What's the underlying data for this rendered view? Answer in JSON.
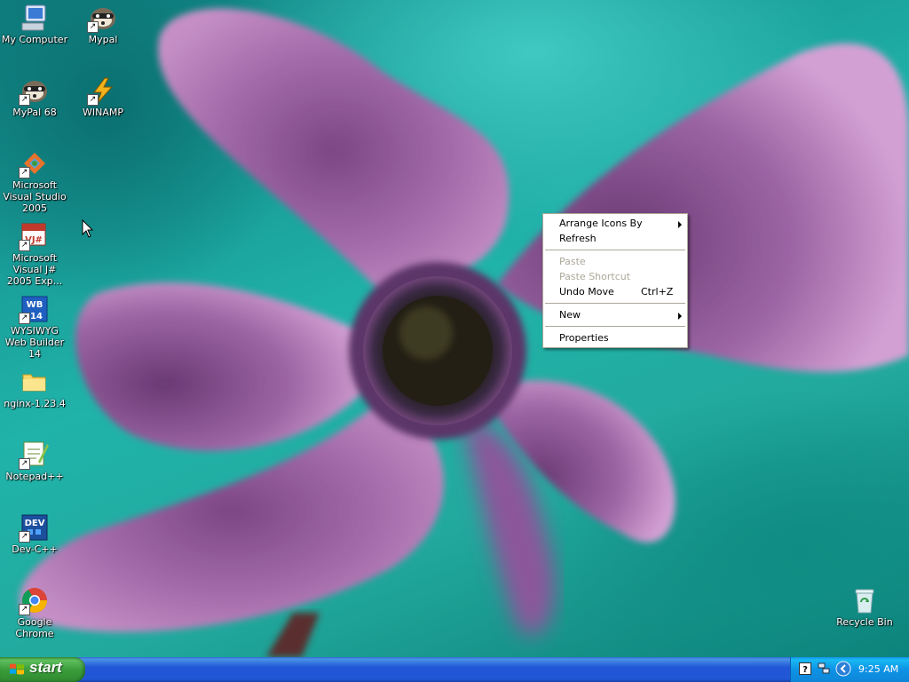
{
  "desktop": {
    "icons": [
      {
        "label": "My Computer",
        "icon": "my-computer-icon"
      },
      {
        "label": "Mypal",
        "icon": "mypal-icon"
      },
      {
        "label": "MyPal 68",
        "icon": "mypal68-icon"
      },
      {
        "label": "WINAMP",
        "icon": "winamp-icon"
      },
      {
        "label": "Microsoft Visual Studio 2005",
        "icon": "visual-studio-icon"
      },
      {
        "label": "Microsoft Visual J# 2005 Exp...",
        "icon": "visual-jsharp-icon"
      },
      {
        "label": "WYSIWYG Web Builder 14",
        "icon": "wysiwyg-web-builder-icon"
      },
      {
        "label": "nginx-1.23.4",
        "icon": "folder-icon"
      },
      {
        "label": "Notepad++",
        "icon": "notepadpp-icon"
      },
      {
        "label": "Dev-C++",
        "icon": "dev-cpp-icon"
      },
      {
        "label": "Google Chrome",
        "icon": "chrome-icon"
      },
      {
        "label": "Recycle Bin",
        "icon": "recycle-bin-icon"
      }
    ],
    "icon_texts": {
      "wysiwyg": "WB",
      "wysiwyg_version": "14",
      "devcpp": "DEV",
      "vjsharp": "VJ#"
    }
  },
  "context_menu": {
    "items": [
      {
        "label": "Arrange Icons By",
        "submenu": true,
        "disabled": false
      },
      {
        "label": "Refresh",
        "disabled": false
      },
      {
        "label": "Paste",
        "disabled": true
      },
      {
        "label": "Paste Shortcut",
        "disabled": true
      },
      {
        "label": "Undo Move",
        "shortcut": "Ctrl+Z",
        "disabled": false
      },
      {
        "label": "New",
        "submenu": true,
        "disabled": false
      },
      {
        "label": "Properties",
        "disabled": false
      }
    ]
  },
  "taskbar": {
    "start_label": "start",
    "clock": "9:25 AM",
    "tray_icons": [
      "help-icon",
      "network-icon",
      "show-hidden-icons-icon"
    ]
  },
  "colors": {
    "taskbar_blue": "#2157d7",
    "start_green": "#3a9d3a",
    "tray_blue": "#0e93e6",
    "wallpaper_teal": "#1aa9a3",
    "flower_purple": "#a36aa8"
  }
}
